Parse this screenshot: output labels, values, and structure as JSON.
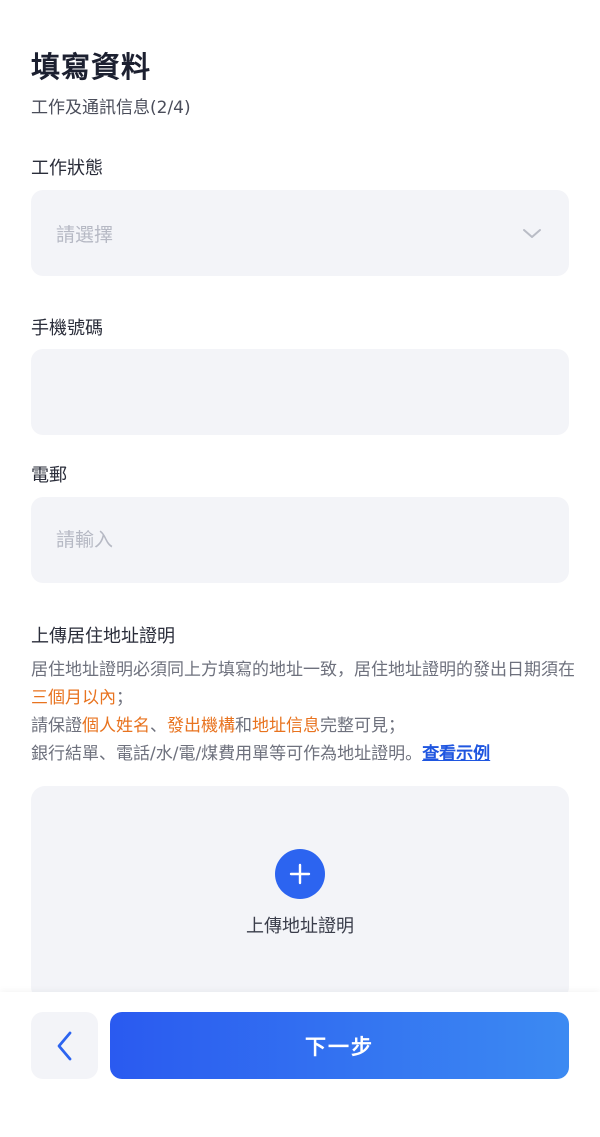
{
  "header": {
    "title": "填寫資料",
    "subtitle": "工作及通訊信息(2/4)"
  },
  "form": {
    "work_status": {
      "label": "工作狀態",
      "placeholder": "請選擇"
    },
    "phone": {
      "label": "手機號碼",
      "value": ""
    },
    "email": {
      "label": "電郵",
      "placeholder": "請輸入"
    }
  },
  "upload": {
    "section_label": "上傳居住地址證明",
    "desc_1": "居住地址證明必須同上方填寫的地址一致，居住地址證明的發出日期須在",
    "desc_1_hl": "三個月以內",
    "desc_1_end": "；",
    "desc_2_start": "請保證",
    "desc_2_hl1": "個人姓名",
    "desc_2_sep1": "、",
    "desc_2_hl2": "發出機構",
    "desc_2_sep2": "和",
    "desc_2_hl3": "地址信息",
    "desc_2_end": "完整可見；",
    "desc_3": "銀行結單、電話/水/電/煤費用單等可作為地址證明。",
    "example_link": "查看示例",
    "upload_button_label": "上傳地址證明"
  },
  "footer": {
    "next_label": "下一步"
  },
  "colors": {
    "primary": "#2c64f0",
    "highlight": "#e8731f",
    "field_bg": "#f3f4f8"
  }
}
